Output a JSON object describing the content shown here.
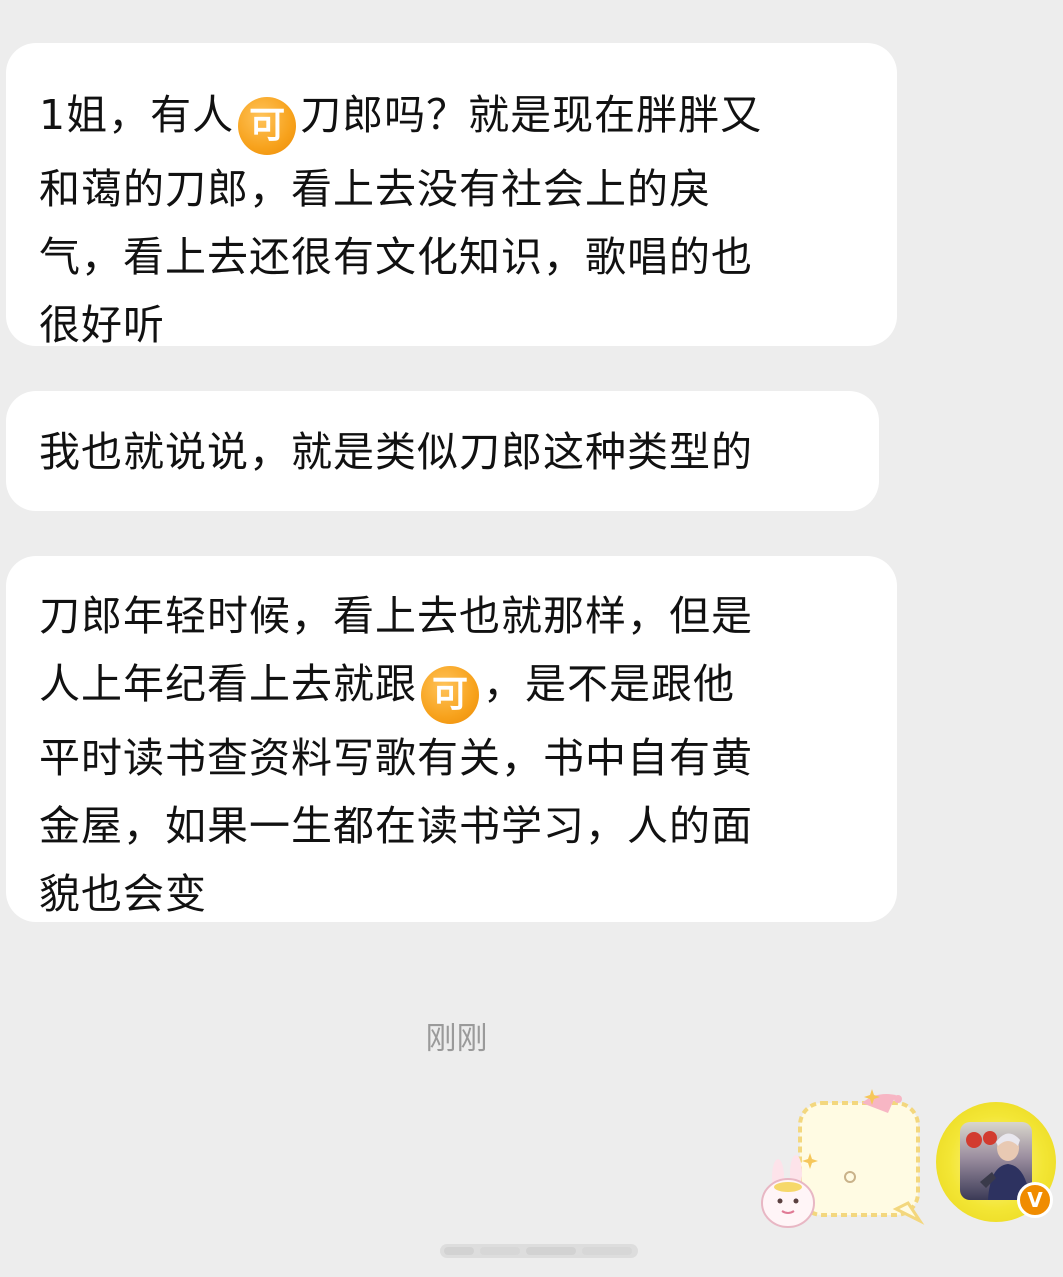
{
  "messages": [
    {
      "lines": [
        [
          "1姐，有人",
          {
            "emoji": "可"
          },
          "刀郎吗？就是现在胖胖又"
        ],
        [
          "和蔼的刀郎，看上去没有社会上的戾"
        ],
        [
          "气，看上去还很有文化知识，歌唱的也"
        ],
        [
          "很好听"
        ]
      ]
    },
    {
      "lines": [
        [
          "我也就说说，就是类似刀郎这种类型的"
        ]
      ]
    },
    {
      "lines": [
        [
          "刀郎年轻时候，看上去也就那样，但是"
        ],
        [
          "人上年纪看上去就跟",
          {
            "emoji": "可"
          },
          "，是不是跟他"
        ],
        [
          "平时读书查资料写歌有关，书中自有黄"
        ],
        [
          "金屋，如果一生都在读书学习，人的面"
        ],
        [
          "貌也会变"
        ]
      ]
    }
  ],
  "timestamp": "刚刚",
  "verified_badge": "V",
  "colors": {
    "background": "#ededed",
    "bubble": "#ffffff",
    "emoji": "#f7a21c",
    "avatar_ring": "#f3e635",
    "badge": "#f08c00"
  },
  "icons": {
    "emoji": "ke-emoji-icon",
    "sticker": "bunny-sticker-icon",
    "avatar": "user-avatar",
    "badge": "verified-badge-icon"
  }
}
